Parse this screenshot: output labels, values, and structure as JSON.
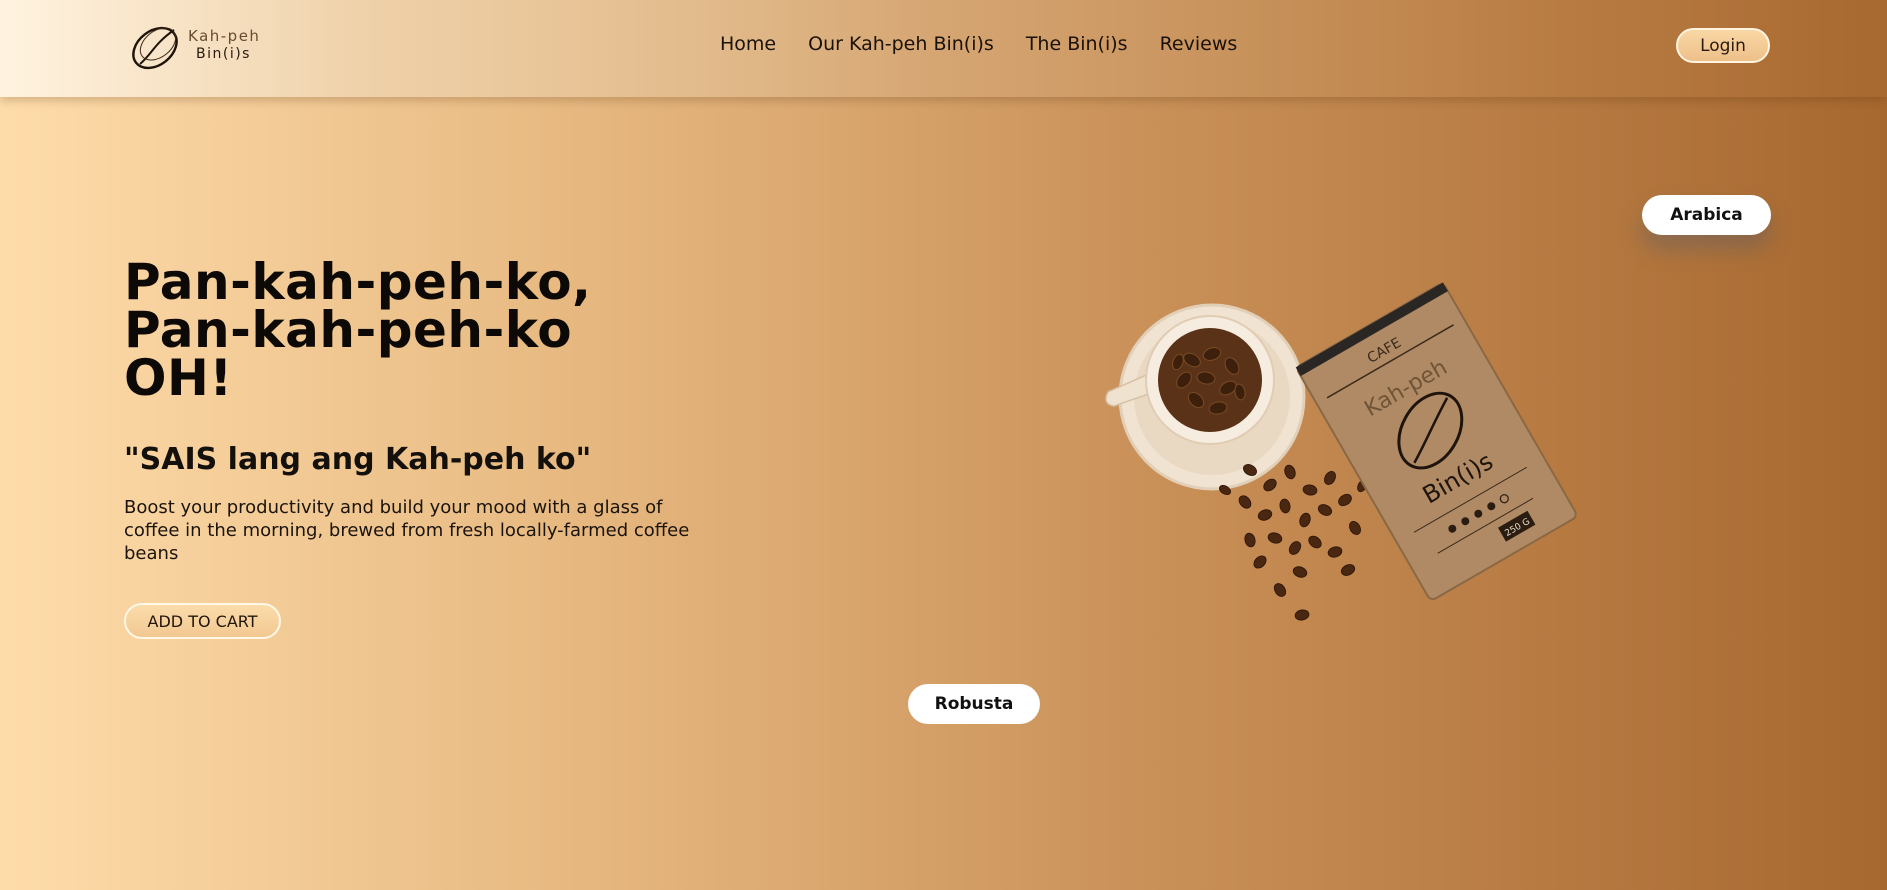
{
  "brand": {
    "line1": "Kah-peh",
    "line2": "Bin(i)s"
  },
  "nav": {
    "items": [
      {
        "label": "Home"
      },
      {
        "label": "Our Kah-peh Bin(i)s"
      },
      {
        "label": "The Bin(i)s"
      },
      {
        "label": "Reviews"
      }
    ]
  },
  "header": {
    "login_label": "Login"
  },
  "hero": {
    "title_lines": [
      "Pan-kah-peh-ko,",
      "Pan-kah-peh-ko",
      "OH!"
    ],
    "subtitle": "\"SAIS lang ang Kah-peh ko\"",
    "description": "Boost your productivity and build your mood with a glass of coffee in the morning, brewed from fresh locally-farmed coffee beans",
    "cart_label": "ADD TO CART"
  },
  "variants": {
    "arabica_label": "Arabica",
    "robusta_label": "Robusta"
  },
  "bag": {
    "top_label": "CAFE",
    "brand_line1": "Kah-peh",
    "brand_line2": "Bin(i)s",
    "weight": "250 G"
  },
  "icons": {
    "logo": "coffee-bean-logo-icon"
  },
  "colors": {
    "bg_left": "#fedcaa",
    "bg_right": "#a7682f",
    "accent": "#f2c891"
  }
}
